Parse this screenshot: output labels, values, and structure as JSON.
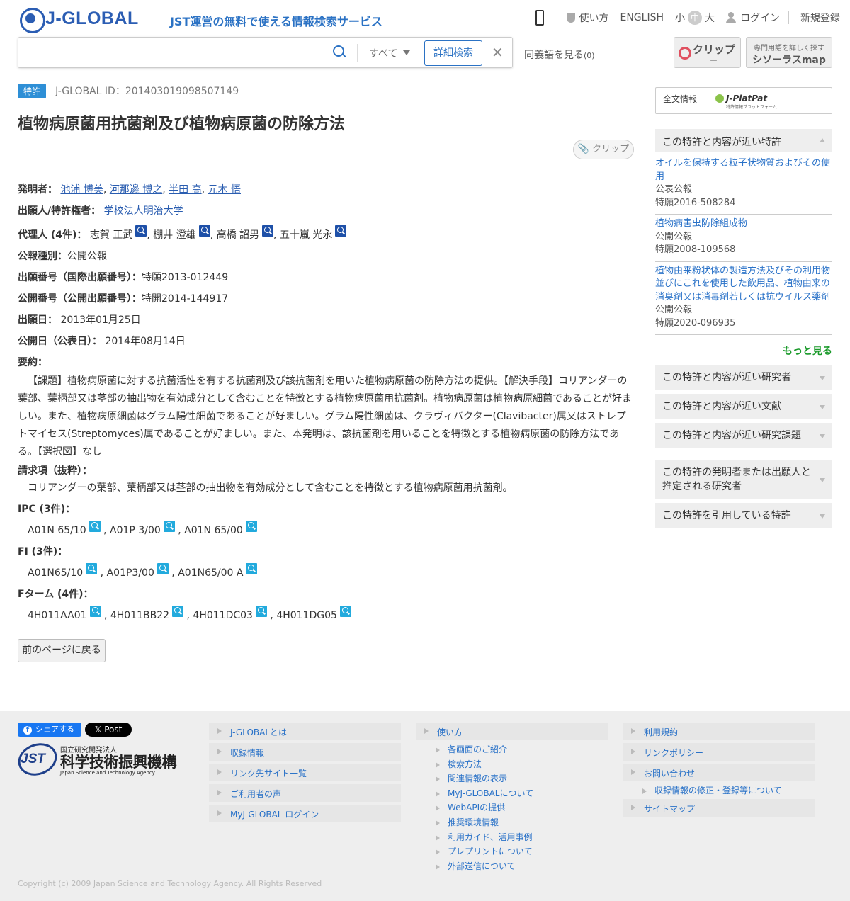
{
  "header": {
    "logo_text": "J-GLOBAL",
    "tagline": "JST運営の無料で使える情報検索サービス",
    "nav": {
      "usage": "使い方",
      "english": "ENGLISH",
      "size_small": "小",
      "size_mid": "中",
      "size_large": "大",
      "login": "ログイン",
      "register": "新規登録"
    },
    "search": {
      "value": "",
      "scope": "すべて",
      "advanced": "詳細検索",
      "clear": "✕"
    },
    "synonyms": {
      "label": "同義語を見る",
      "count": "(0)"
    },
    "clip": {
      "label": "クリップ",
      "count": "ー"
    },
    "thesaurus": {
      "sub": "専門用語を詳しく探す",
      "label": "シソーラスmap"
    }
  },
  "main": {
    "badge": "特許",
    "jglobal_id": "J-GLOBAL ID：201403019098507149",
    "title": "植物病原菌用抗菌剤及び植物病原菌の防除方法",
    "clip_button": "クリップ",
    "fields": {
      "inventors_label": "発明者：",
      "inventors": [
        "池浦 博美",
        "河那邊 博之",
        "半田 高",
        "元木 悟"
      ],
      "applicant_label": "出願人/特許権者：",
      "applicant": "学校法人明治大学",
      "agents_label": "代理人 (4件)：",
      "agents": [
        "志賀 正武",
        "棚井 澄雄",
        "高橋 詔男",
        "五十嵐 光永"
      ],
      "pub_type_label": "公報種別：",
      "pub_type": "公開公報",
      "app_no_label": "出願番号（国際出願番号）：",
      "app_no": "特願2013-012449",
      "pub_no_label": "公開番号（公開出願番号）：",
      "pub_no": "特開2014-144917",
      "app_date_label": "出願日：",
      "app_date": "2013年01月25日",
      "pub_date_label": "公開日（公表日）：",
      "pub_date": "2014年08月14日",
      "abstract_label": "要約：",
      "abstract": "【課題】植物病原菌に対する抗菌活性を有する抗菌剤及び該抗菌剤を用いた植物病原菌の防除方法の提供。【解決手段】コリアンダーの葉部、葉柄部又は茎部の抽出物を有効成分として含むことを特徴とする植物病原菌用抗菌剤。植物病原菌は植物病原細菌であることが好ましい。また、植物病原細菌はグラム陽性細菌であることが好ましい。グラム陽性細菌は、クラヴィバクター(Clavibacter)属又はストレプトマイセス(Streptomyces)属であることが好ましい。また、本発明は、該抗菌剤を用いることを特徴とする植物病原菌の防除方法である。【選択図】なし",
      "claims_label": "請求項（抜粋）：",
      "claims": "コリアンダーの葉部、葉柄部又は茎部の抽出物を有効成分として含むことを特徴とする植物病原菌用抗菌剤。",
      "ipc_label": "IPC (3件)：",
      "ipc": [
        "A01N 65/10",
        "A01P 3/00",
        "A01N 65/00"
      ],
      "fi_label": "FI (3件)：",
      "fi": [
        "A01N65/10",
        "A01P3/00",
        "A01N65/00 A"
      ],
      "fterm_label": "Fターム (4件)：",
      "fterm": [
        "4H011AA01",
        "4H011BB22",
        "4H011DC03",
        "4H011DG05"
      ]
    },
    "back_button": "前のページに戻る"
  },
  "sidebar": {
    "fulltext_label": "全文情報",
    "jplatpat": "J-PlatPat",
    "jplatpat_sub": "特許情報プラットフォーム",
    "similar_header": "この特許と内容が近い特許",
    "similar": [
      {
        "title": "オイルを保持する粒子状物質およびその使用",
        "type": "公表公報",
        "number": "特願2016-508284"
      },
      {
        "title": "植物病害虫防除組成物",
        "type": "公開公報",
        "number": "特願2008-109568"
      },
      {
        "title": "植物由来粉状体の製造方法及びその利用物並びにこれを使用した飲用品、植物由来の消臭剤又は消毒剤若しくは抗ウイルス薬剤",
        "type": "公開公報",
        "number": "特願2020-096935"
      }
    ],
    "more": "もっと見る",
    "sections": [
      "この特許と内容が近い研究者",
      "この特許と内容が近い文献",
      "この特許と内容が近い研究課題",
      "この特許の発明者または出願人と推定される研究者",
      "この特許を引用している特許"
    ]
  },
  "footer": {
    "share": "シェアする",
    "post": "Post",
    "jst_line1": "国立研究開発法人",
    "jst_line2": "科学技術振興機構",
    "jst_line3": "Japan Science and Technology Agency",
    "col1": [
      "J-GLOBALとは",
      "収録情報",
      "リンク先サイト一覧",
      "ご利用者の声",
      "MyJ-GLOBAL ログイン"
    ],
    "col2_head": "使い方",
    "col2": [
      "各画面のご紹介",
      "検索方法",
      "関連情報の表示",
      "MyJ-GLOBALについて",
      "WebAPIの提供",
      "推奨環境情報",
      "利用ガイド、活用事例",
      "プレプリントについて",
      "外部送信について"
    ],
    "col3": [
      "利用規約",
      "リンクポリシー",
      "お問い合わせ"
    ],
    "col3_sub": "収録情報の修正・登録等について",
    "col3_last": "サイトマップ",
    "copyright": "Copyright (c) 2009 Japan Science and Technology Agency. All Rights Reserved"
  }
}
